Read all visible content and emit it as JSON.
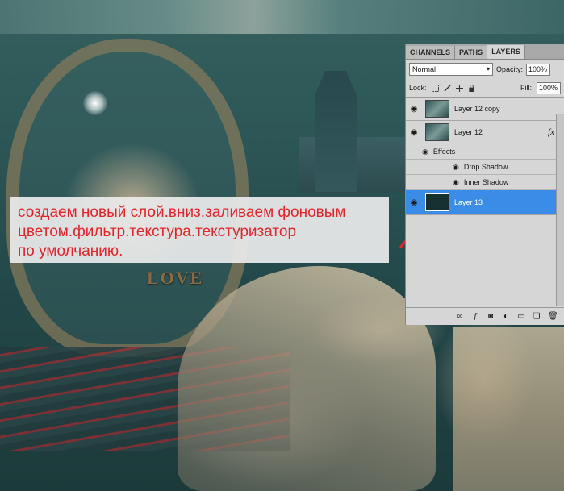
{
  "caption": {
    "lines": [
      "создаем новый слой.вниз.заливаем фоновым",
      "цветом.фильтр.текстура.текстуризатор",
      "по умолчанию."
    ]
  },
  "artwork": {
    "love_text": "LOVE"
  },
  "panel": {
    "tabs": [
      "CHANNELS",
      "PATHS",
      "LAYERS"
    ],
    "active_tab": "LAYERS",
    "blend_mode": "Normal",
    "opacity_label": "Opacity:",
    "opacity_value": "100%",
    "lock_label": "Lock:",
    "fill_label": "Fill:",
    "fill_value": "100%",
    "layers": [
      {
        "name": "Layer 12 copy",
        "visible": true,
        "selected": false,
        "fx": ""
      },
      {
        "name": "Layer 12",
        "visible": true,
        "selected": false,
        "fx": "fx"
      },
      {
        "name": "Layer 13",
        "visible": true,
        "selected": true,
        "fx": ""
      }
    ],
    "effects_label": "Effects",
    "effects": [
      "Drop Shadow",
      "Inner Shadow"
    ],
    "bottom_icons": [
      "link-icon",
      "fx-icon",
      "mask-icon",
      "adjustment-icon",
      "folder-icon",
      "new-layer-icon",
      "trash-icon"
    ]
  },
  "colors": {
    "caption_text": "#e2252b",
    "selection": "#3b8ce6"
  }
}
